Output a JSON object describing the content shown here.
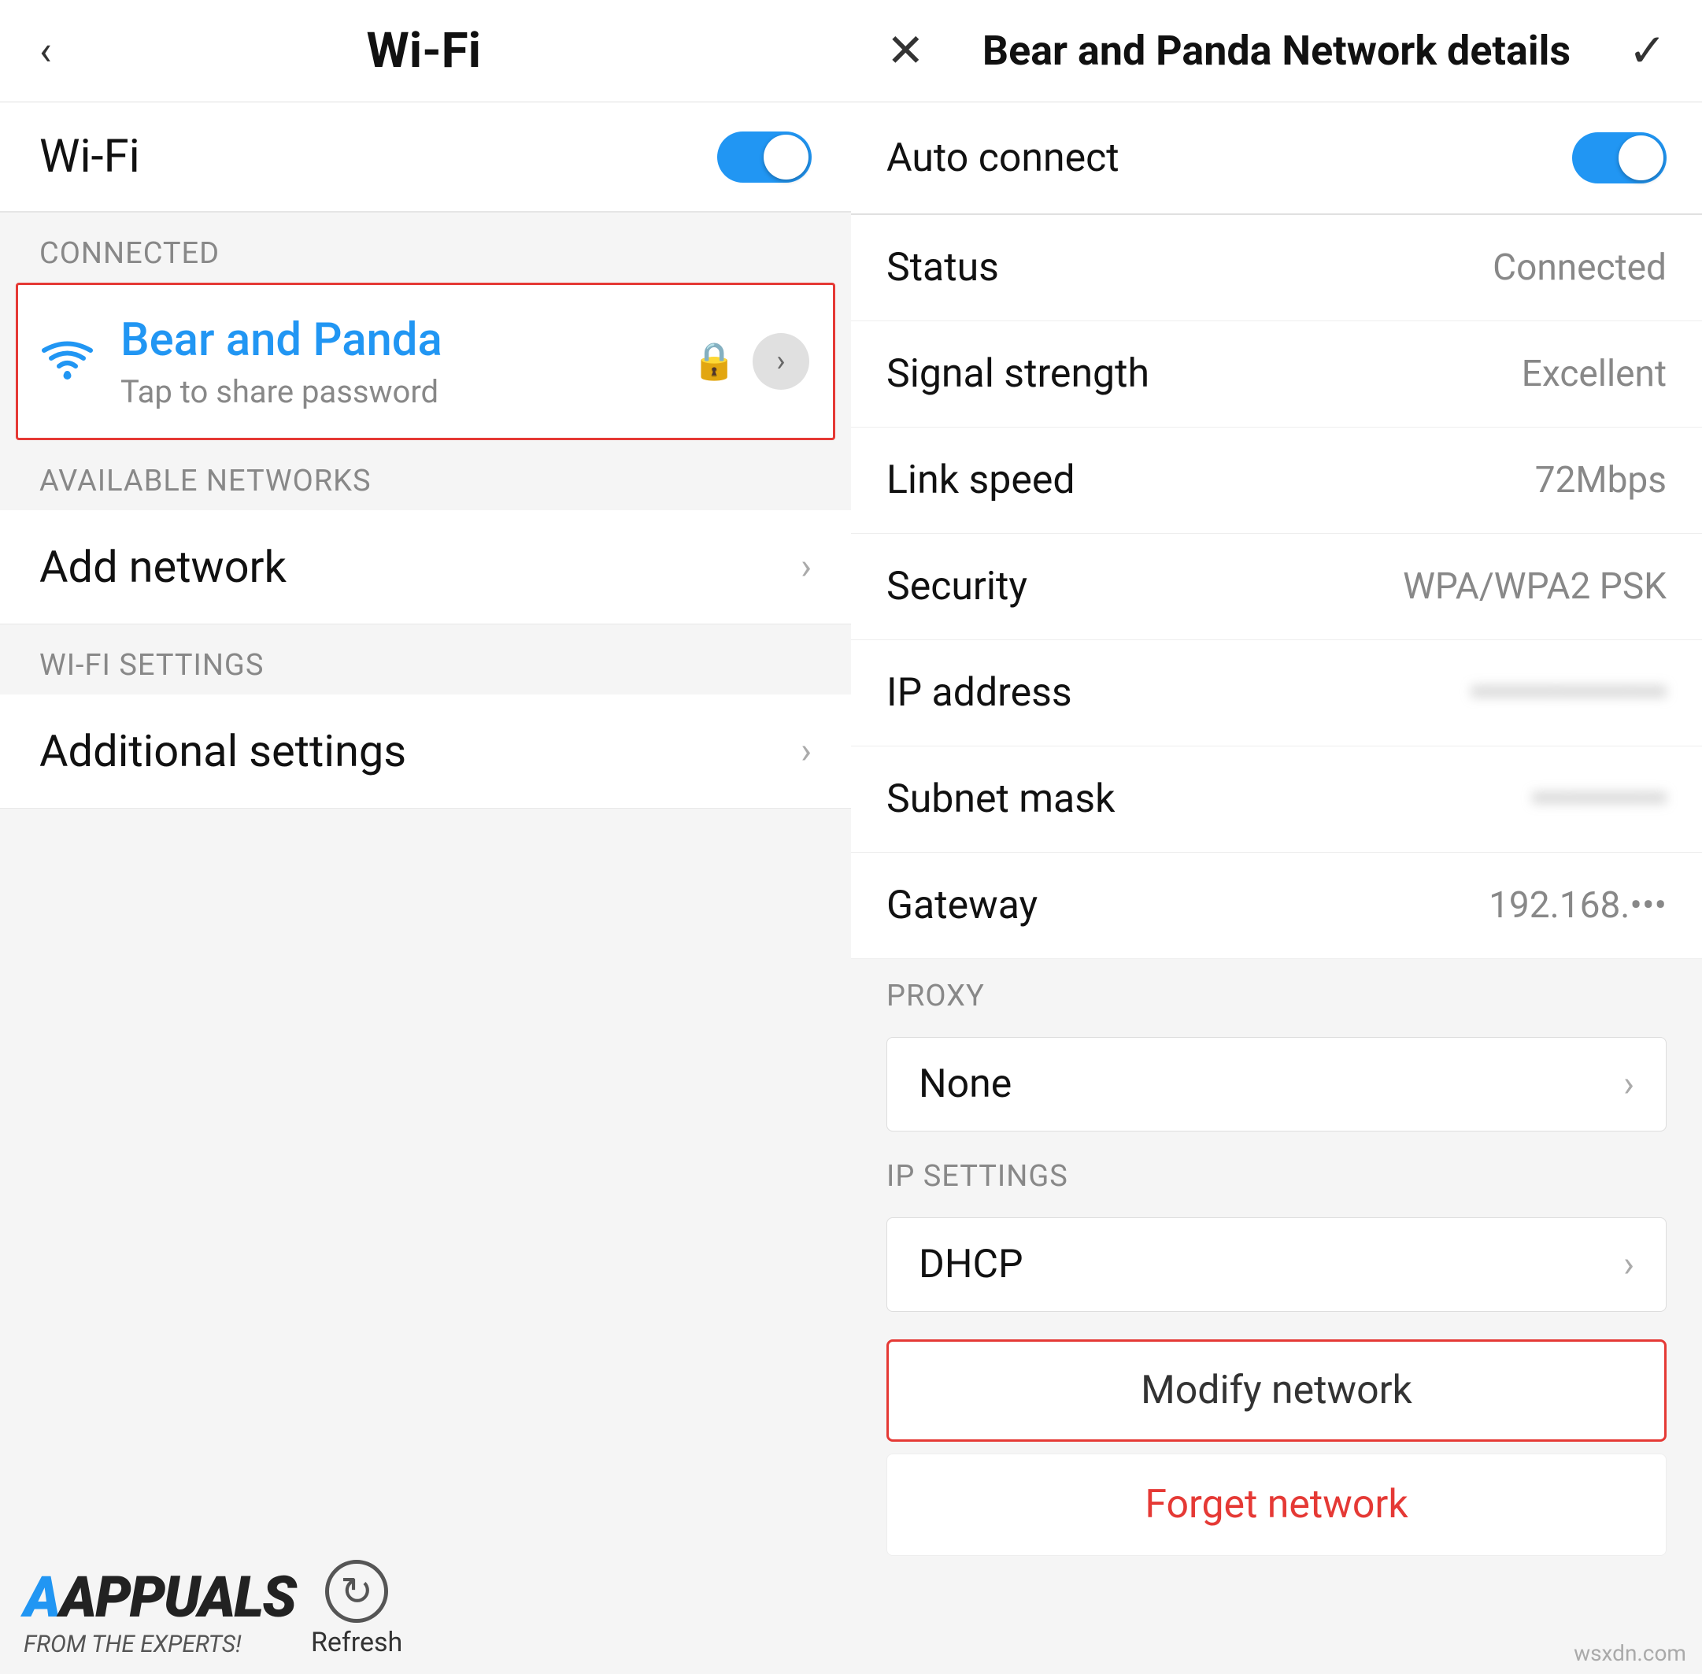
{
  "left": {
    "header": {
      "back_label": "‹",
      "title": "Wi-Fi"
    },
    "wifi_toggle": {
      "label": "Wi-Fi",
      "enabled": true
    },
    "connected_section": {
      "label": "CONNECTED"
    },
    "connected_network": {
      "name": "Bear and Panda",
      "sub": "Tap to share password",
      "lock_icon": "🔒",
      "chevron": "›"
    },
    "available_section": {
      "label": "AVAILABLE NETWORKS"
    },
    "add_network": {
      "label": "Add network",
      "chevron": "›"
    },
    "wifi_settings_section": {
      "label": "WI-FI SETTINGS"
    },
    "additional_settings": {
      "label": "Additional settings",
      "chevron": "›"
    },
    "watermark": {
      "logo": "APPUALS",
      "sub": "FROM THE EXPERTS!",
      "refresh": "Refresh"
    }
  },
  "right": {
    "header": {
      "close": "✕",
      "title": "Bear and Panda Network details",
      "check": "✓"
    },
    "auto_connect": {
      "label": "Auto connect"
    },
    "status": {
      "label": "Status",
      "value": "Connected"
    },
    "signal_strength": {
      "label": "Signal strength",
      "value": "Excellent"
    },
    "link_speed": {
      "label": "Link speed",
      "value": "72Mbps"
    },
    "security": {
      "label": "Security",
      "value": "WPA/WPA2 PSK"
    },
    "ip_address": {
      "label": "IP address",
      "value": "••••••••••••••••"
    },
    "subnet_mask": {
      "label": "Subnet mask",
      "value": "•••••••••••"
    },
    "gateway": {
      "label": "Gateway",
      "value": "192.168.•••"
    },
    "proxy_section": {
      "label": "PROXY",
      "value": "None",
      "chevron": "›"
    },
    "ip_settings_section": {
      "label": "IP SETTINGS",
      "value": "DHCP",
      "chevron": "›"
    },
    "modify_network": {
      "label": "Modify network"
    },
    "forget_network": {
      "label": "Forget network"
    },
    "watermark": "wsxdn.com"
  }
}
